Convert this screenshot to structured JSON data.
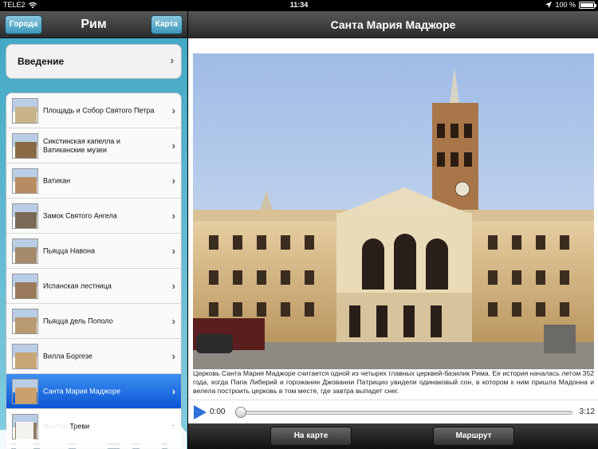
{
  "status": {
    "carrier": "TELE2",
    "time": "11:34",
    "battery": "100 %",
    "battery_level": 1.0
  },
  "sidebar": {
    "title": "Рим",
    "left_button": "Города",
    "right_button": "Карта",
    "intro": "Введение",
    "items": [
      {
        "label": "Площадь и Собор Святого Петра",
        "thumb": "#c9b38a"
      },
      {
        "label": "Сикстинская капелла и Ватиканские музеи",
        "thumb": "#8a6a45"
      },
      {
        "label": "Ватикан",
        "thumb": "#b88c63"
      },
      {
        "label": "Замок Святого Ангела",
        "thumb": "#7a6a55"
      },
      {
        "label": "Пьяцца Навона",
        "thumb": "#a48a6a"
      },
      {
        "label": "Испанская лестница",
        "thumb": "#9a7a5a"
      },
      {
        "label": "Пьяцца дель Пополо",
        "thumb": "#b89a72"
      },
      {
        "label": "Вилла Боргезе",
        "thumb": "#c7a575"
      },
      {
        "label": "Санта Мария Маджоре",
        "thumb": "#caa06c",
        "selected": true
      },
      {
        "label": "Фонтан Треви",
        "thumb": "#8e7a60"
      }
    ]
  },
  "main": {
    "title": "Санта Мария Маджоре",
    "description": "Церковь Санта Мария Маджоре считается одной из четырех главных церквей-базилик Рима. Ее история началась летом 352 года, когда Папа Либерий и горожанин Джованни Патрицио увидели одинаковый сон, в котором к ним пришла Мадонна и велела построить церковь в том месте, где завтра выпадет снег.",
    "player": {
      "current": "0:00",
      "duration": "3:12",
      "progress": 0
    },
    "buttons": {
      "map": "На карте",
      "route": "Маршрут"
    }
  },
  "colors": {
    "sidebar": "#7ec3d8",
    "selected": "#1464e0",
    "nav": "#3a3a3a",
    "play": "#2f6fd8"
  }
}
